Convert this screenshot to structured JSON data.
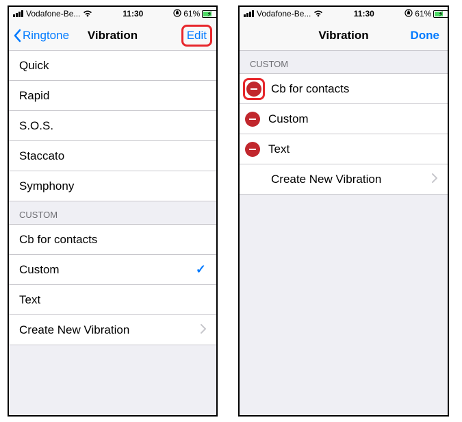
{
  "status": {
    "carrier": "Vodafone-Be...",
    "time": "11:30",
    "battery_pct": "61%",
    "battery_level": 61
  },
  "left": {
    "nav": {
      "back": "Ringtone",
      "title": "Vibration",
      "edit": "Edit"
    },
    "standard": [
      "Quick",
      "Rapid",
      "S.O.S.",
      "Staccato",
      "Symphony"
    ],
    "custom_header": "Custom",
    "custom": [
      {
        "label": "Cb for contacts",
        "selected": false
      },
      {
        "label": "Custom",
        "selected": true
      },
      {
        "label": "Text",
        "selected": false
      }
    ],
    "create": "Create New Vibration"
  },
  "right": {
    "nav": {
      "title": "Vibration",
      "done": "Done"
    },
    "custom_header": "Custom",
    "custom": [
      {
        "label": "Cb for contacts",
        "highlighted": true
      },
      {
        "label": "Custom",
        "highlighted": false
      },
      {
        "label": "Text",
        "highlighted": false
      }
    ],
    "create": "Create New Vibration"
  }
}
